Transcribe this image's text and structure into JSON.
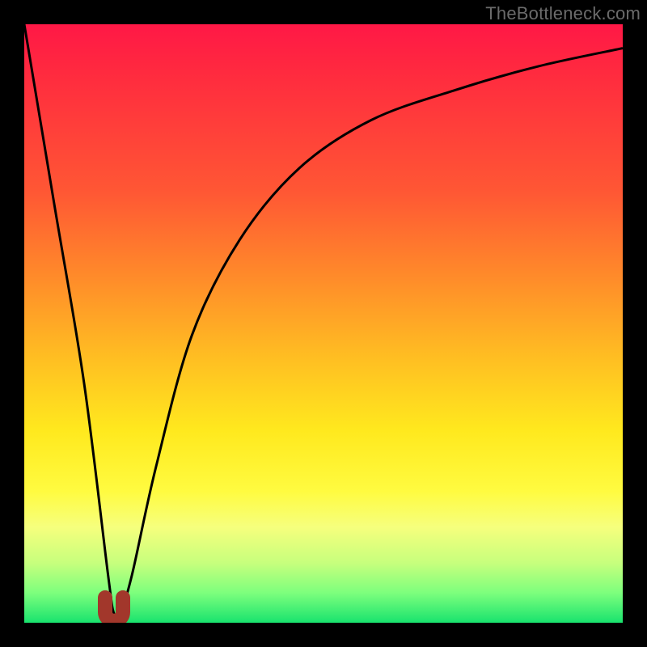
{
  "watermark": "TheBottleneck.com",
  "chart_data": {
    "type": "line",
    "title": "",
    "xlabel": "",
    "ylabel": "",
    "xlim": [
      0,
      100
    ],
    "ylim": [
      0,
      100
    ],
    "grid": false,
    "legend": false,
    "series": [
      {
        "name": "bottleneck-curve",
        "x": [
          0,
          5,
          10,
          14,
          15,
          16,
          18,
          22,
          28,
          36,
          46,
          58,
          72,
          86,
          100
        ],
        "values": [
          100,
          70,
          40,
          8,
          1.5,
          1.5,
          8,
          26,
          48,
          64,
          76,
          84,
          89,
          93,
          96
        ]
      }
    ],
    "annotations": [
      {
        "type": "marker",
        "shape": "u-glyph",
        "x": 15,
        "y": 1.5,
        "color": "#a2372b"
      }
    ],
    "background_gradient_top_to_bottom": [
      "#ff1846",
      "#ff8a2a",
      "#ffe91e",
      "#19e36e"
    ]
  }
}
